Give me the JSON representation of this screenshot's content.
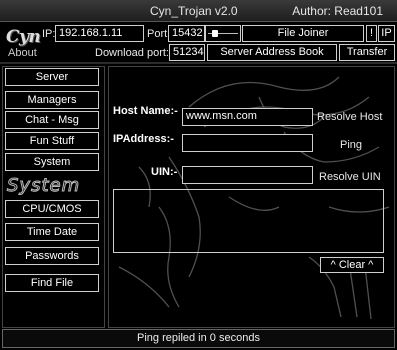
{
  "titlebar": {
    "title": "Cyn_Trojan v2.0",
    "author": "Author: Read101"
  },
  "logo": {
    "brand": "Cyn",
    "about": "About"
  },
  "connection": {
    "ip_label": "IP:",
    "ip_value": "192.168.1.11",
    "port_label": "Port:",
    "port_value": "15432",
    "download_port_label": "Download port:",
    "download_port_value": "51234"
  },
  "toolbar": {
    "file_joiner": "File Joiner",
    "bang": "!",
    "ip_btn": "IP",
    "server_address_book": "Server Address Book",
    "transfer": "Transfer"
  },
  "sidebar": {
    "items_top": [
      "Server",
      "Managers",
      "Chat - Msg",
      "Fun Stuff",
      "System"
    ],
    "section_title": "System",
    "items_bottom": [
      "CPU/CMOS",
      "Time Date",
      "Passwords",
      "Find File"
    ]
  },
  "main": {
    "host_label": "Host Name:-",
    "host_value": "www.msn.com",
    "resolve_host": "Resolve Host",
    "ip_label": "IPAddress:-",
    "ip_value": "",
    "ping": "Ping",
    "uin_label": "UIN:-",
    "uin_value": "",
    "resolve_uin": "Resolve UIN",
    "clear": "^ Clear ^"
  },
  "status": {
    "text": "Ping repiled in 0 seconds"
  }
}
